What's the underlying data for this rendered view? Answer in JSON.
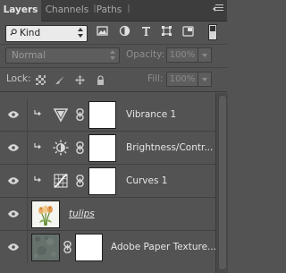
{
  "tabs": [
    {
      "label": "Layers",
      "active": true
    },
    {
      "label": "Channels",
      "active": false
    },
    {
      "label": "Paths",
      "active": false
    }
  ],
  "filter": {
    "kind_label": "Kind",
    "icons": [
      "image-filter-icon",
      "adjustment-filter-icon",
      "type-filter-icon",
      "shape-filter-icon",
      "smart-object-filter-icon"
    ]
  },
  "blend": {
    "mode": "Normal",
    "opacity_label": "Opacity:",
    "opacity_value": "100%"
  },
  "lock": {
    "label": "Lock:",
    "fill_label": "Fill:",
    "fill_value": "100%"
  },
  "layers": [
    {
      "name": "Vibrance 1",
      "type": "adjustment",
      "icon": "vibrance-icon",
      "clipped": true,
      "visible": true
    },
    {
      "name": "Brightness/Contr...",
      "type": "adjustment",
      "icon": "brightness-contrast-icon",
      "clipped": true,
      "visible": true
    },
    {
      "name": "Curves 1",
      "type": "adjustment",
      "icon": "curves-icon",
      "clipped": true,
      "visible": true
    },
    {
      "name": "tulips",
      "type": "pixel",
      "icon": "tulips-thumbnail",
      "clipped": false,
      "visible": true
    },
    {
      "name": "Adobe Paper Texture...",
      "type": "pixel-with-mask",
      "icon": "paper-texture-thumbnail",
      "clipped": false,
      "visible": true
    }
  ]
}
